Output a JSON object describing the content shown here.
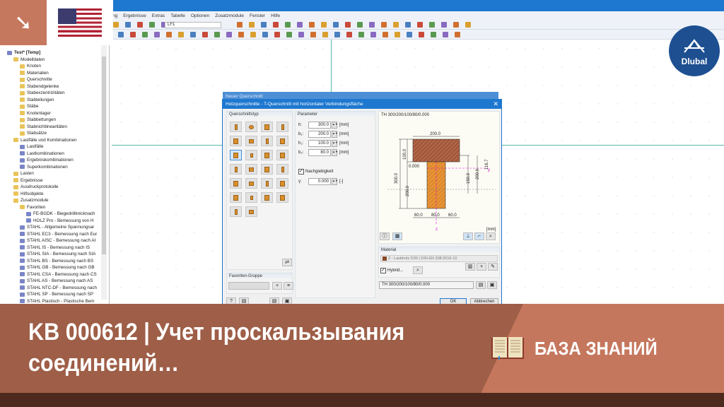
{
  "menu": [
    "...ung",
    "Ergebnisse",
    "Extras",
    "Tabelle",
    "Optionen",
    "Zusatzmodule",
    "Fenster",
    "Hilfe"
  ],
  "toolbar": {
    "loadcase": "LF1"
  },
  "brand": {
    "name": "Dlubal",
    "accent": "#1d4f91"
  },
  "tree": [
    {
      "label": "Test* [Temp]",
      "level": 0,
      "icon": "model"
    },
    {
      "label": "Modelldaten",
      "level": 1,
      "icon": "folder"
    },
    {
      "label": "Knoten",
      "level": 2,
      "icon": "folder"
    },
    {
      "label": "Materialien",
      "level": 2,
      "icon": "folder"
    },
    {
      "label": "Querschnitte",
      "level": 2,
      "icon": "folder"
    },
    {
      "label": "Stabendgelenke",
      "level": 2,
      "icon": "folder"
    },
    {
      "label": "Stabexzentrizitäten",
      "level": 2,
      "icon": "folder"
    },
    {
      "label": "Stabteilungen",
      "level": 2,
      "icon": "folder"
    },
    {
      "label": "Stäbe",
      "level": 2,
      "icon": "folder"
    },
    {
      "label": "Knotenlager",
      "level": 2,
      "icon": "folder"
    },
    {
      "label": "Stabbettungen",
      "level": 2,
      "icon": "folder"
    },
    {
      "label": "Stabnichtlinearitäten",
      "level": 2,
      "icon": "folder"
    },
    {
      "label": "Stabsätze",
      "level": 2,
      "icon": "folder"
    },
    {
      "label": "Lastfälle und Kombinationen",
      "level": 1,
      "icon": "folder"
    },
    {
      "label": "Lastfälle",
      "level": 2,
      "icon": "module"
    },
    {
      "label": "Lastkombinationen",
      "level": 2,
      "icon": "module"
    },
    {
      "label": "Ergebniskombinationen",
      "level": 2,
      "icon": "module"
    },
    {
      "label": "Superkombinationen",
      "level": 2,
      "icon": "module"
    },
    {
      "label": "Lasten",
      "level": 1,
      "icon": "folder"
    },
    {
      "label": "Ergebnisse",
      "level": 1,
      "icon": "folder"
    },
    {
      "label": "Ausdruckprotokolle",
      "level": 1,
      "icon": "folder"
    },
    {
      "label": "Hilfsobjekte",
      "level": 1,
      "icon": "folder"
    },
    {
      "label": "Zusatzmodule",
      "level": 1,
      "icon": "folder"
    },
    {
      "label": "Favoriten",
      "level": 2,
      "icon": "folder"
    },
    {
      "label": "FE-BGDK - Biegedrillknicknach",
      "level": 3,
      "icon": "module"
    },
    {
      "label": "HOLZ Pro - Bemessung von H",
      "level": 3,
      "icon": "module"
    },
    {
      "label": "STAHL - Allgemeine Spannungsar",
      "level": 2,
      "icon": "module"
    },
    {
      "label": "STAHL EC3 - Bemessung nach Eur",
      "level": 2,
      "icon": "module"
    },
    {
      "label": "STAHL AISC - Bemessung nach AI",
      "level": 2,
      "icon": "module"
    },
    {
      "label": "STAHL IS - Bemessung nach IS",
      "level": 2,
      "icon": "module"
    },
    {
      "label": "STAHL SIA - Bemessung nach SIA",
      "level": 2,
      "icon": "module"
    },
    {
      "label": "STAHL BS - Bemessung nach BS",
      "level": 2,
      "icon": "module"
    },
    {
      "label": "STAHL GB - Bemessung nach GB",
      "level": 2,
      "icon": "module"
    },
    {
      "label": "STAHL CSA - Bemessung nach CS",
      "level": 2,
      "icon": "module"
    },
    {
      "label": "STAHL AS - Bemessung nach AS",
      "level": 2,
      "icon": "module"
    },
    {
      "label": "STAHL NTC-DF - Bemessung nach",
      "level": 2,
      "icon": "module"
    },
    {
      "label": "STAHL SP - Bemessung nach SP",
      "level": 2,
      "icon": "module"
    },
    {
      "label": "STAHL Plastisch - Plastische Bem",
      "level": 2,
      "icon": "module"
    }
  ],
  "dialog": {
    "back_title": "Neuer Querschnitt",
    "title": "Holzquerschnitte - T-Querschnitt mit horizontaler Verbindungsfläche",
    "type_panel": "Querschnittstyp",
    "fav_panel": "Favoriten-Gruppe",
    "param_panel": "Parameter",
    "params": [
      {
        "label": "h:",
        "value": "300.0",
        "unit": "[mm]"
      },
      {
        "label": "b₁:",
        "value": "200.0",
        "unit": "[mm]"
      },
      {
        "label": "h₁:",
        "value": "100.0",
        "unit": "[mm]"
      },
      {
        "label": "b₂:",
        "value": "80.0",
        "unit": "[mm]"
      }
    ],
    "nachgiebigkeit": {
      "label": "Nachgiebigkeit",
      "checked": true
    },
    "gamma": {
      "label": "γ:",
      "value": "0.000",
      "unit": "[-]"
    },
    "preview": {
      "name": "TH 300/200/100/80/0.000",
      "unit": "[mm]",
      "dims": {
        "top": "200.0",
        "flange": "100.0",
        "total": "300.0",
        "web": "200.0",
        "joint": "0.000",
        "d1": "150.0",
        "d2": "200.0",
        "d3": "116.7",
        "b_left": "60.0",
        "b_mid": "80.0",
        "b_right": "60.0",
        "axis_y": "y",
        "axis_z": "z"
      }
    },
    "material_panel": "Material",
    "material": "2 - Laubholz D30 | DIN EN 338:2016-10",
    "material_color": "#8a4a2a",
    "hybrid": {
      "label": "Hybrid...",
      "checked": true
    },
    "section_name": "TH 300/200/100/80/0.000",
    "ok": "OK",
    "cancel": "Abbrechen"
  },
  "banner": {
    "title": "KB 000612 | Учет проскальзывания соединений…",
    "category": "БАЗА ЗНАНИЙ"
  }
}
